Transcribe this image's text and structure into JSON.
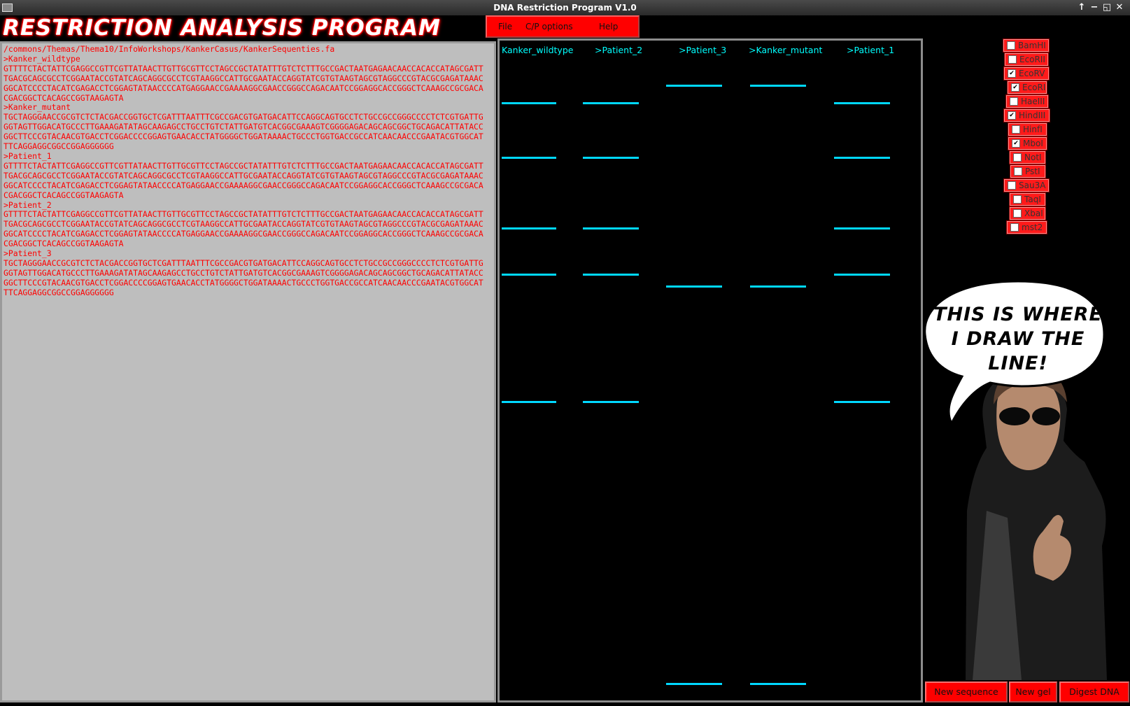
{
  "window": {
    "title": "DNA Restriction Program V1.0",
    "controls": [
      "↑",
      "−",
      "◱",
      "✕"
    ]
  },
  "app": {
    "title": "RESTRICTION ANALYSIS PROGRAM"
  },
  "menu": {
    "file": "File",
    "cp_options": "C/P options",
    "help": "Help"
  },
  "sequence": {
    "text": "/commons/Themas/Thema10/InfoWorkshops/KankerCasus/KankerSequenties.fa\n>Kanker_wildtype\nGTTTTCTACTATTCGAGGCCGTTCGTTATAACTTGTTGCGTTCCTAGCCGCTATATTTGTCTCTTTGCCGACTAATGAGAACAACCACACCATAGCGATT\nTGACGCAGCGCCTCGGAATACCGTATCAGCAGGCGCCTCGTAAGGCCATTGCGAATACCAGGTATCGTGTAAGTAGCGTAGGCCCGTACGCGAGATAAAC\nGGCATCCCCTACATCGAGACCTCGGAGTATAACCCCATGAGGAACCGAAAAGGCGAACCGGGCCAGACAATCCGGAGGCACCGGGCTCAAAGCCGCGACA\nCGACGGCTCACAGCCGGTAAGAGTA\n>Kanker_mutant\nTGCTAGGGAACCGCGTCTCTACGACCGGTGCTCGATTTAATTTCGCCGACGTGATGACATTCCAGGCAGTGCCTCTGCCGCCGGGCCCCTCTCGTGATTG\nGGTAGTTGGACATGCCCTTGAAAGATATAGCAAGAGCCTGCCTGTCTATTGATGTCACGGCGAAAGTCGGGGAGACAGCAGCGGCTGCAGACATTATACC\nGGCTTCCCGTACAACGTGACCTCGGACCCCGGAGTGAACACCTATGGGGCTGGATAAAACTGCCCTGGTGACCGCCATCAACAACCCGAATACGTGGCAT\nTTCAGGAGGCGGCCGGAGGGGGG\n>Patient_1\nGTTTTCTACTATTCGAGGCCGTTCGTTATAACTTGTTGCGTTCCTAGCCGCTATATTTGTCTCTTTGCCGACTAATGAGAACAACCACACCATAGCGATT\nTGACGCAGCGCCTCGGAATACCGTATCAGCAGGCGCCTCGTAAGGCCATTGCGAATACCAGGTATCGTGTAAGTAGCGTAGGCCCGTACGCGAGATAAAC\nGGCATCCCCTACATCGAGACCTCGGAGTATAACCCCATGAGGAACCGAAAAGGCGAACCGGGCCAGACAATCCGGAGGCACCGGGCTCAAAGCCGCGACA\nCGACGGCTCACAGCCGGTAAGAGTA\n>Patient_2\nGTTTTCTACTATTCGAGGCCGTTCGTTATAACTTGTTGCGTTCCTAGCCGCTATATTTGTCTCTTTGCCGACTAATGAGAACAACCACACCATAGCGATT\nTGACGCAGCGCCTCGGAATACCGTATCAGCAGGCGCCTCGTAAGGCCATTGCGAATACCAGGTATCGTGTAAGTAGCGTAGGCCCGTACGCGAGATAAAC\nGGCATCCCCTACATCGAGACCTCGGAGTATAACCCCATGAGGAACCGAAAAGGCGAACCGGGCCAGACAATCCGGAGGCACCGGGCTCAAAGCCGCGACA\nCGACGGCTCACAGCCGGTAAGAGTA\n>Patient_3\nTGCTAGGGAACCGCGTCTCTACGACCGGTGCTCGATTTAATTTCGCCGACGTGATGACATTCCAGGCAGTGCCTCTGCCGCCGGGCCCCTCTCGTGATTG\nGGTAGTTGGACATGCCCTTGAAAGATATAGCAAGAGCCTGCCTGTCTATTGATGTCACGGCGAAAGTCGGGGAGACAGCAGCGGCTGCAGACATTATACC\nGGCTTCCCGTACAACGTGACCTCGGACCCCGGAGTGAACACCTATGGGGCTGGATAAAACTGCCCTGGTGACCGCCATCAACAACCCGAATACGTGGCAT\nTTCAGGAGGCGGCCGGAGGGGGG"
  },
  "gel": {
    "lanes": [
      {
        "label": "Kanker_wildtype"
      },
      {
        "label": ">Patient_2"
      },
      {
        "label": ">Patient_3"
      },
      {
        "label": ">Kanker_mutant"
      },
      {
        "label": ">Patient_1"
      }
    ],
    "band_color": "#00d8ff",
    "label_color": "#00ffff"
  },
  "enzymes": [
    {
      "name": "BamHI",
      "checked": false
    },
    {
      "name": "EcoRII",
      "checked": false
    },
    {
      "name": "EcoRV",
      "checked": true
    },
    {
      "name": "EcoRI",
      "checked": true
    },
    {
      "name": "HaeIII",
      "checked": false
    },
    {
      "name": "HindIII",
      "checked": true
    },
    {
      "name": "HinfI",
      "checked": false
    },
    {
      "name": "MboI",
      "checked": true
    },
    {
      "name": "NotI",
      "checked": false
    },
    {
      "name": "PstI",
      "checked": false
    },
    {
      "name": "Sau3A",
      "checked": false
    },
    {
      "name": "TaqI",
      "checked": false
    },
    {
      "name": "XbaI",
      "checked": false
    },
    {
      "name": "mst2",
      "checked": false
    }
  ],
  "comic": {
    "speech": "THIS IS WHERE I DRAW THE LINE!"
  },
  "buttons": {
    "new_sequence": "New sequence",
    "new_gel": "New gel",
    "digest_dna": "Digest DNA"
  },
  "colors": {
    "accent": "#ff0000",
    "sequence_text": "#ff0000",
    "sequence_bg": "#bebebe"
  }
}
